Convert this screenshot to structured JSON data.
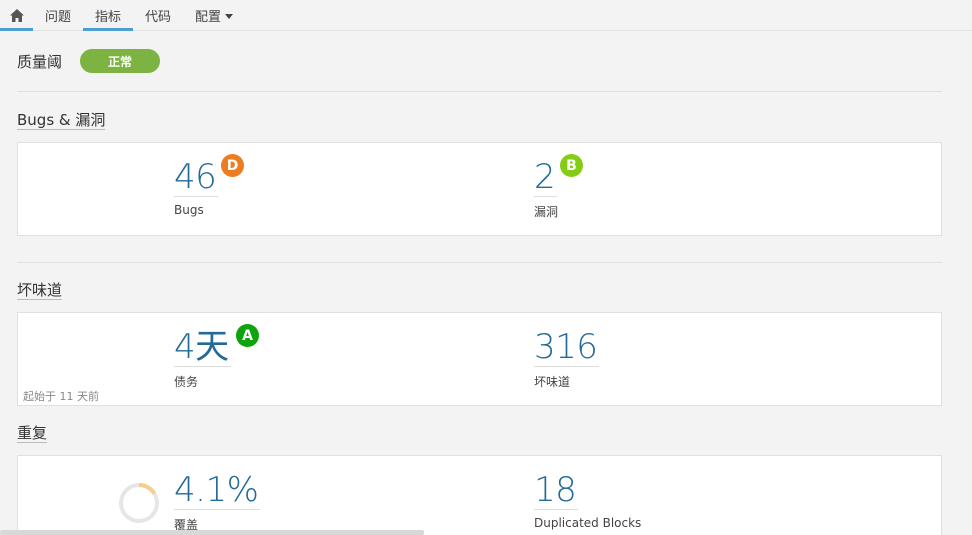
{
  "nav": {
    "home_icon": "home-icon",
    "items": [
      {
        "label": "问题"
      },
      {
        "label": "指标"
      },
      {
        "label": "代码"
      },
      {
        "label": "配置"
      }
    ]
  },
  "quality_gate": {
    "title": "质量阈",
    "status": "正常",
    "status_color": "#7cb342"
  },
  "bugs_section": {
    "title": "Bugs & 漏洞",
    "bugs": {
      "value": "46",
      "label": "Bugs",
      "rating": "D",
      "rating_color": "#ed7d20"
    },
    "vulnerabilities": {
      "value": "2",
      "label": "漏洞",
      "rating": "B",
      "rating_color": "#85cc14"
    }
  },
  "smells_section": {
    "title": "坏味道",
    "debt": {
      "value": "4天",
      "label": "债务",
      "rating": "A",
      "rating_color": "#0ea40e"
    },
    "smells": {
      "value": "316",
      "label": "坏味道"
    },
    "since": "起始于 11 天前"
  },
  "dup_section": {
    "title": "重复",
    "coverage": {
      "value": "4.1%",
      "label": "覆盖",
      "fraction": 0.041
    },
    "blocks": {
      "value": "18",
      "label": "Duplicated Blocks"
    }
  }
}
